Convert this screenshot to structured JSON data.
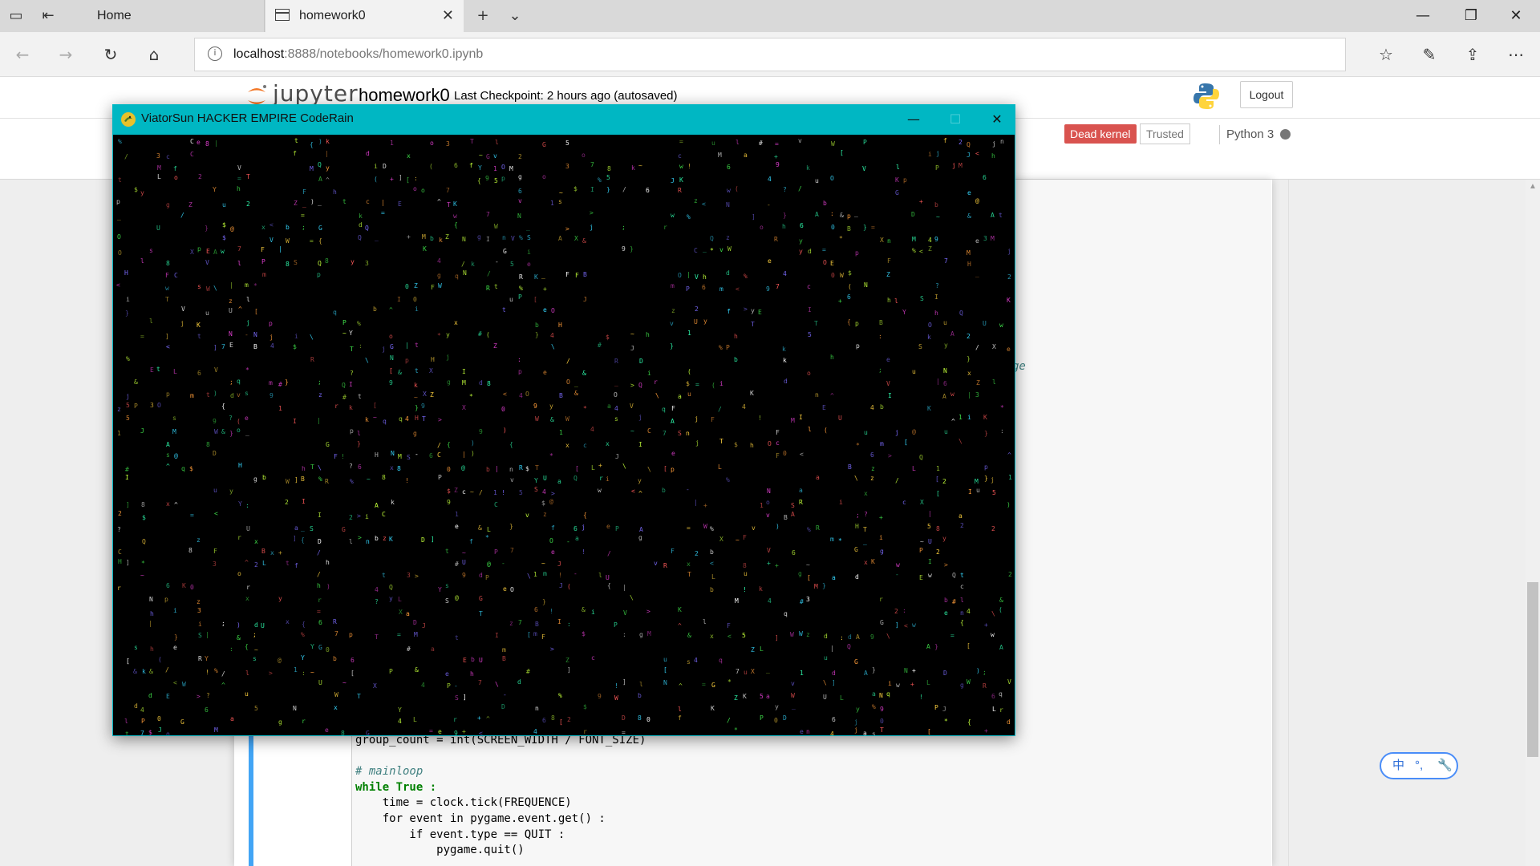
{
  "browser": {
    "tabs": [
      {
        "label": "Home"
      },
      {
        "label": "homework0"
      }
    ],
    "address": {
      "host": "localhost",
      "path": ":8888/notebooks/homework0.ipynb"
    },
    "icons": {
      "tab_manager": "tab-manager-icon",
      "set_aside": "set-aside-tabs-icon",
      "new_tab": "plus-icon",
      "tab_list": "chevron-down-icon",
      "back": "back-arrow-icon",
      "forward": "forward-arrow-icon",
      "refresh": "refresh-icon",
      "home": "home-icon",
      "favorites": "favorites-icon",
      "notes": "pen-icon",
      "share": "share-icon",
      "more": "more-icon"
    }
  },
  "jupyter": {
    "logo_text": "jupyter",
    "notebook_name": "homework0",
    "checkpoint": "Last Checkpoint: 2 hours ago  (autosaved)",
    "logout_label": "Logout",
    "kernel_status": "Dead kernel",
    "trusted_label": "Trusted",
    "kernel_name": "Python 3"
  },
  "code_lines": [
    "group_count = int(SCREEN_WIDTH / FONT_SIZE)",
    "",
    "# mainloop",
    "while True :",
    "    time = clock.tick(FREQUENCE)",
    "    for event in pygame.event.get() :",
    "        if event.type == QUIT :",
    "            pygame.quit()"
  ],
  "stray_text": "ge",
  "ime": {
    "char1": "中",
    "char2": "°,"
  },
  "pygame_window": {
    "title": "ViatorSun HACKER EMPIRE CodeRain",
    "titlebar_color": "#00b7c3",
    "canvas_color": "#000000"
  },
  "rain": {
    "glyphs": "abcdefghijklmnopqrstuvwxyzABCDEFGHIJKLMNOPQRSTUVWXYZ0123456789!@#$%&*()[]{}<>?;:~^=+-_/\\|",
    "colors": [
      "#3fe04a",
      "#e03fd0",
      "#36d8ff",
      "#ffd23f",
      "#ff5a5a",
      "#7c6cff",
      "#ffffff",
      "#ff9d3a",
      "#2fffb0",
      "#c3ff3a"
    ]
  },
  "colors": {
    "kernel_dead": "#d9534f",
    "cell_selected": "#42a5f5"
  }
}
